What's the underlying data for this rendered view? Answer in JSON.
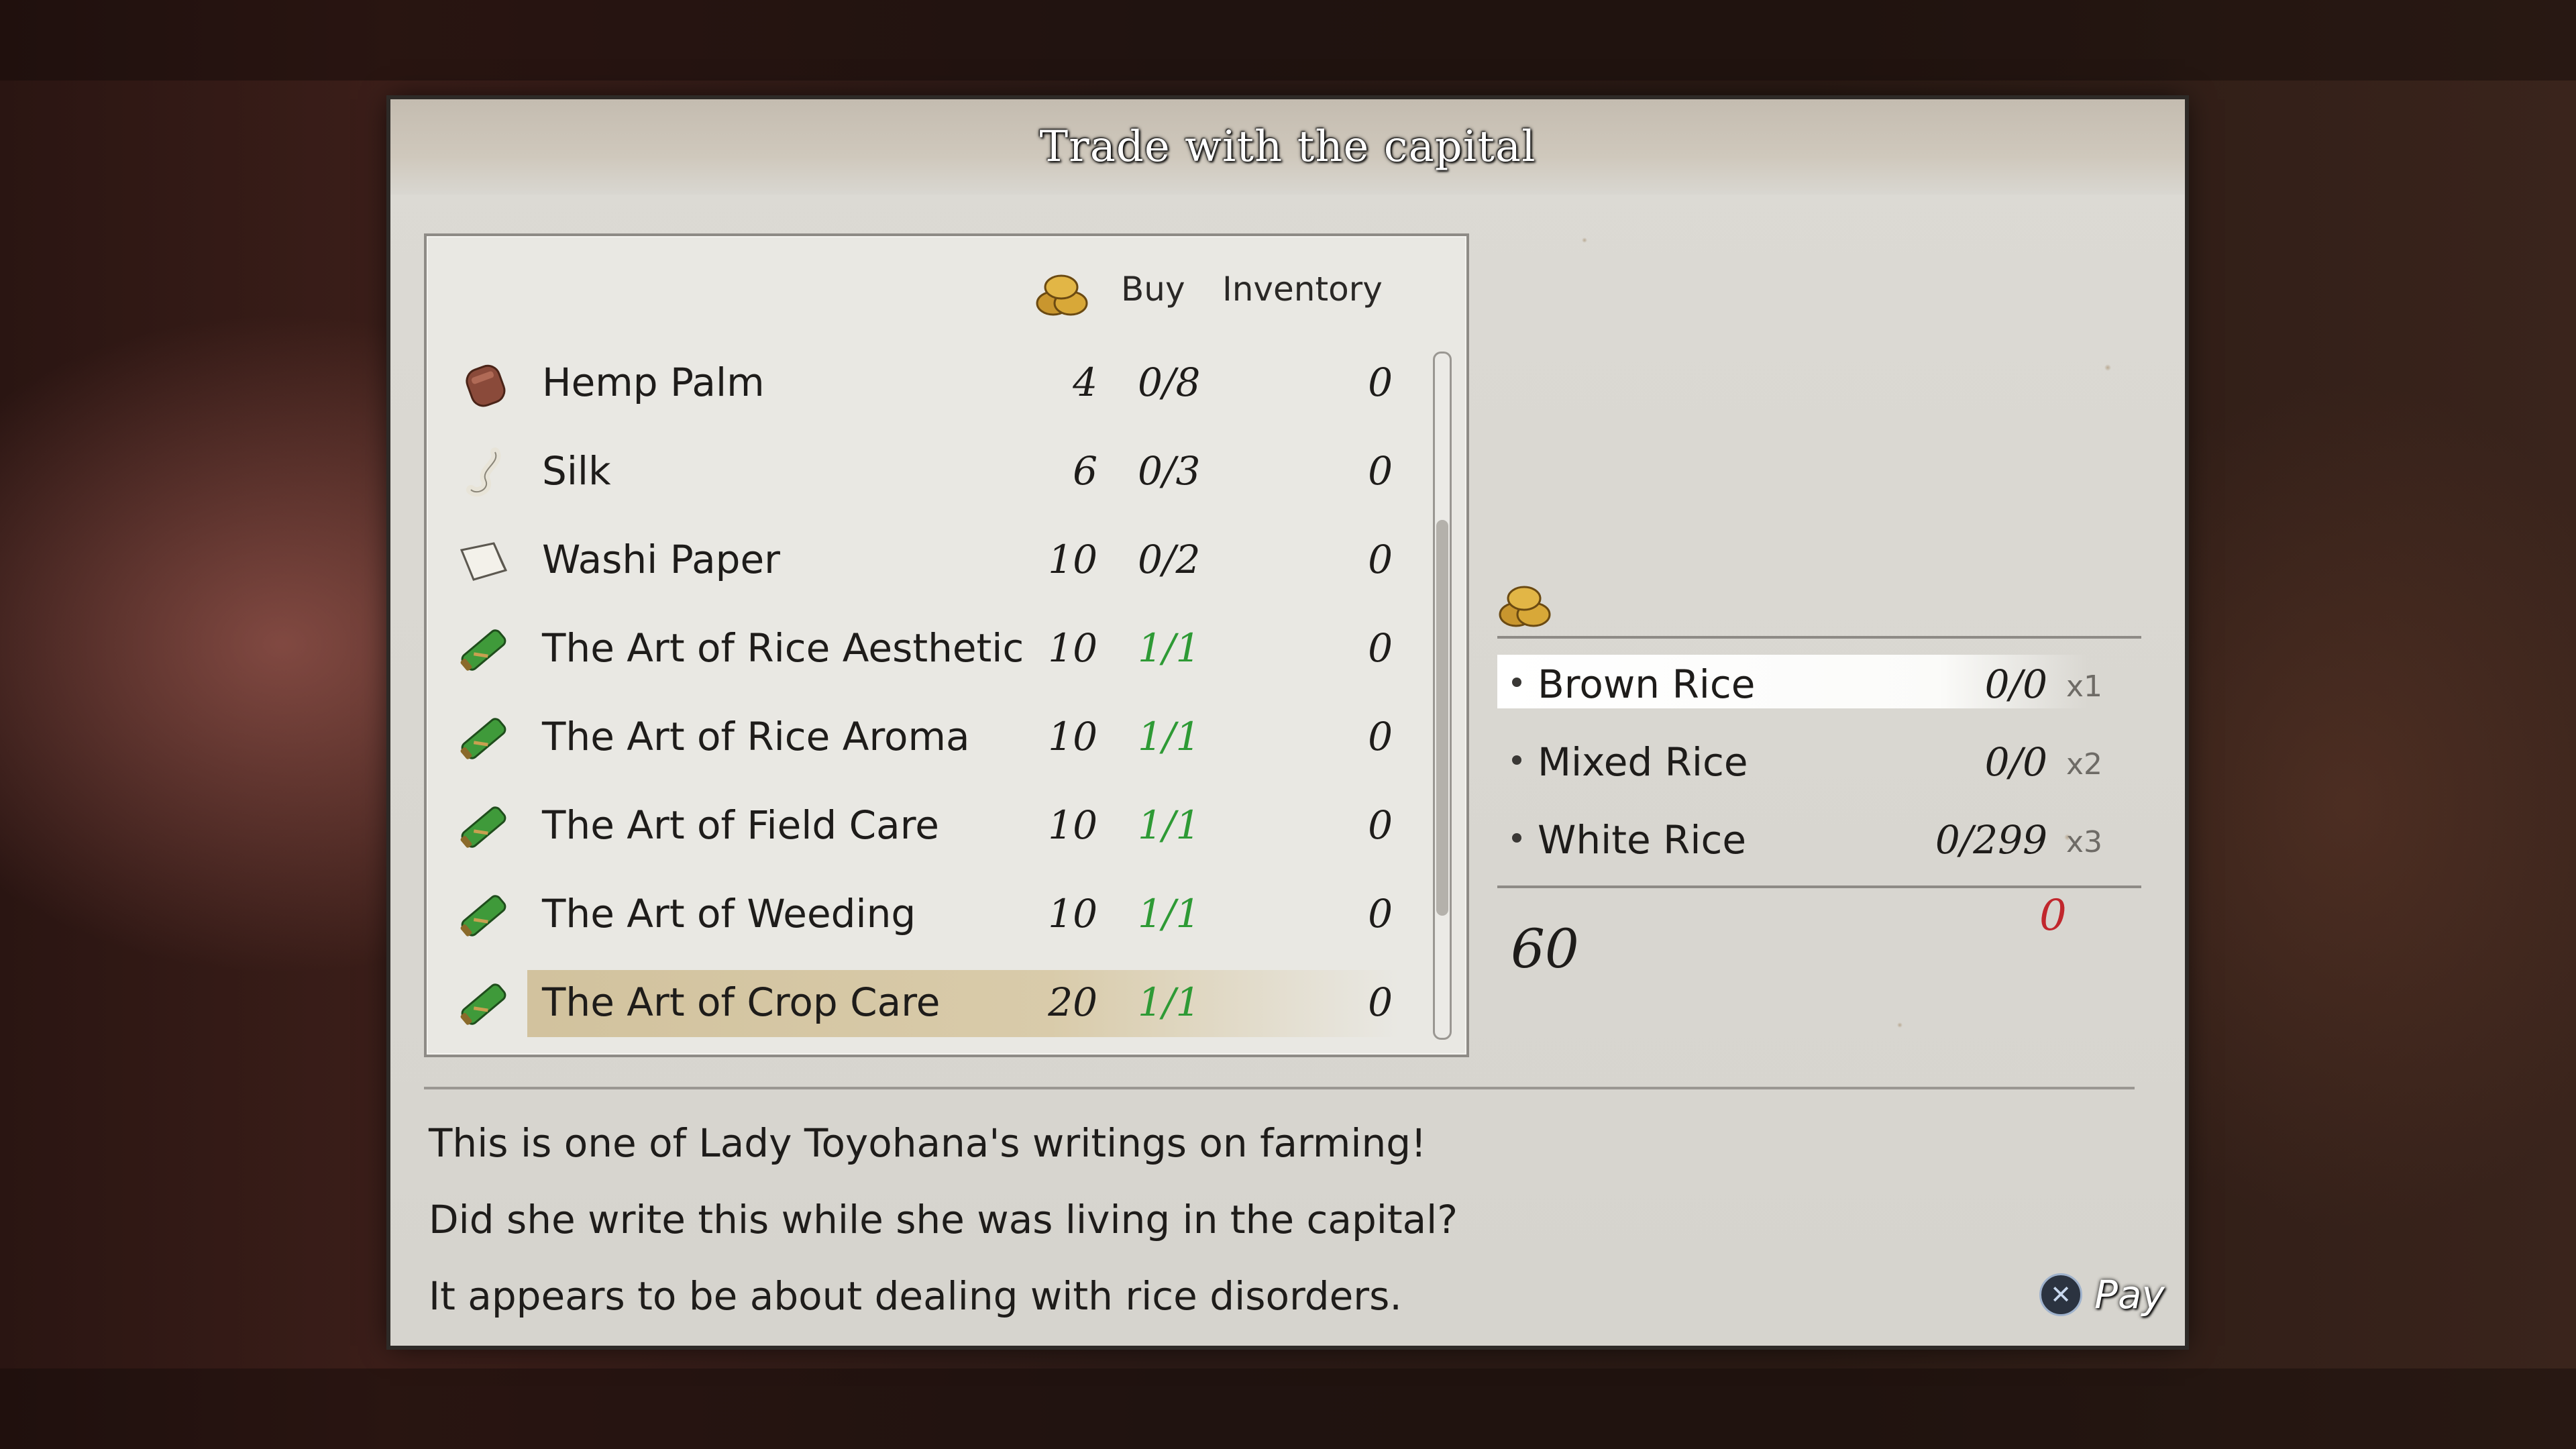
{
  "window": {
    "title": "Trade with the capital"
  },
  "list": {
    "headers": {
      "price_icon": "rice-bale-icon",
      "buy": "Buy",
      "inventory": "Inventory"
    },
    "items": [
      {
        "name": "Hemp Palm",
        "icon": "hemp-palm-icon",
        "price": "4",
        "buy": "0/8",
        "inventory": "0"
      },
      {
        "name": "Silk",
        "icon": "silk-icon",
        "price": "6",
        "buy": "0/3",
        "inventory": "0"
      },
      {
        "name": "Washi Paper",
        "icon": "washi-paper-icon",
        "price": "10",
        "buy": "0/2",
        "inventory": "0"
      },
      {
        "name": "The Art of Rice Aesthetic",
        "icon": "scroll-icon",
        "price": "10",
        "buy": "1/1",
        "inventory": "0"
      },
      {
        "name": "The Art of Rice Aroma",
        "icon": "scroll-icon",
        "price": "10",
        "buy": "1/1",
        "inventory": "0"
      },
      {
        "name": "The Art of Field Care",
        "icon": "scroll-icon",
        "price": "10",
        "buy": "1/1",
        "inventory": "0"
      },
      {
        "name": "The Art of Weeding",
        "icon": "scroll-icon",
        "price": "10",
        "buy": "1/1",
        "inventory": "0"
      },
      {
        "name": "The Art of Crop Care",
        "icon": "scroll-icon",
        "price": "20",
        "buy": "1/1",
        "inventory": "0"
      }
    ],
    "selected_index": 7,
    "scroll_position": 0.58
  },
  "payment": {
    "icon": "rice-bale-icon",
    "options": [
      {
        "name": "Brown Rice",
        "count": "0/0",
        "multiplier": "x1"
      },
      {
        "name": "Mixed Rice",
        "count": "0/0",
        "multiplier": "x2"
      },
      {
        "name": "White Rice",
        "count": "0/299",
        "multiplier": "x3"
      }
    ],
    "total": "60",
    "cost": "0"
  },
  "description": {
    "lines": [
      "This is one of Lady Toyohana's writings on farming!",
      "Did she write this while she was living in the capital?",
      "It appears to be about dealing with rice disorders."
    ]
  },
  "actions": {
    "pay_button_glyph": "✕",
    "pay_label": "Pay"
  },
  "colors": {
    "available": "#2e9a35",
    "cost": "#c1272d",
    "selected_row": "#cfbe96"
  }
}
